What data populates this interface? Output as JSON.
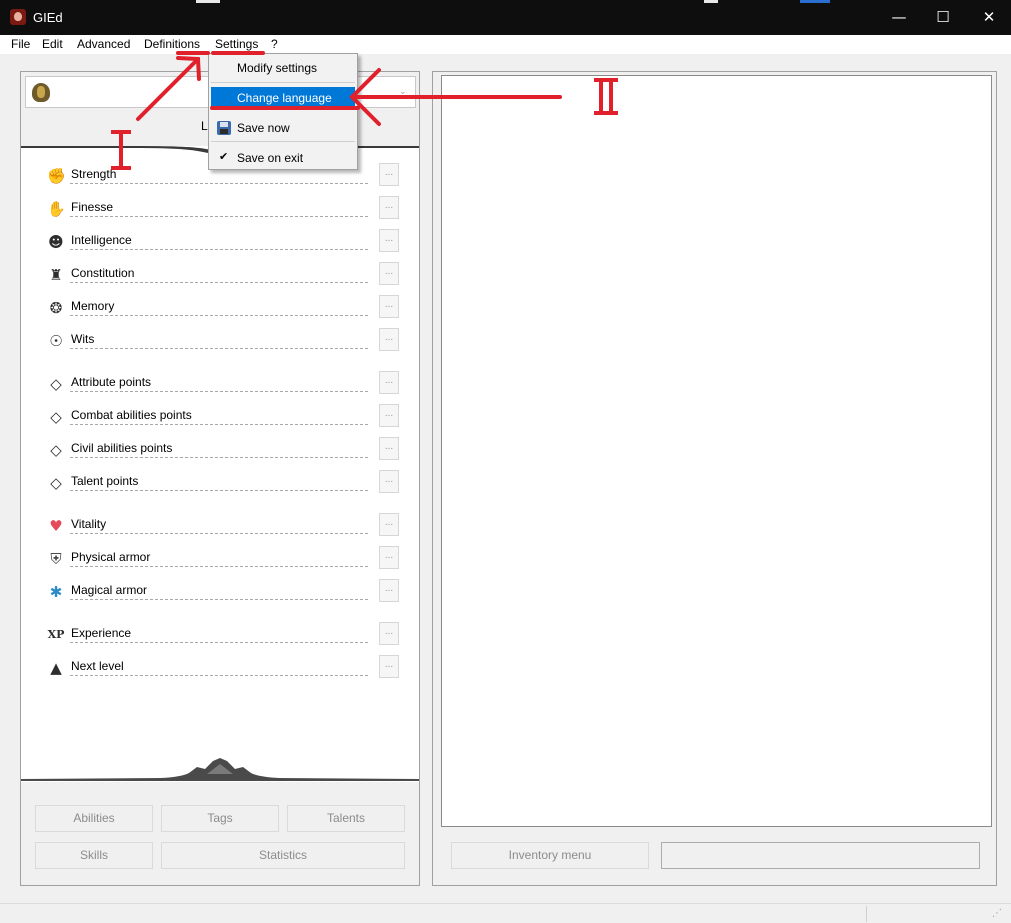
{
  "window": {
    "title": "GIEd",
    "controls": {
      "minimize": "—",
      "maximize": "☐",
      "close": "✕"
    }
  },
  "menu": [
    "File",
    "Edit",
    "Advanced",
    "Definitions",
    "Settings",
    "?"
  ],
  "settings_menu": {
    "items": [
      {
        "label": "Modify settings",
        "icon": "none",
        "highlighted": false
      },
      {
        "label": "Change language",
        "icon": "none",
        "highlighted": true
      },
      {
        "label": "Save now",
        "icon": "floppy-disk-icon",
        "highlighted": false
      },
      {
        "label": "Save on exit",
        "icon": "checkmark-icon",
        "checked": true,
        "highlighted": false
      }
    ]
  },
  "character": {
    "level_label": "L",
    "dropdown_arrow": "⌄"
  },
  "attributes": [
    {
      "label": "Strength",
      "icon": "strength-icon",
      "glyph": "✊",
      "button": "..."
    },
    {
      "label": "Finesse",
      "icon": "finesse-icon",
      "glyph": "✋",
      "button": "..."
    },
    {
      "label": "Intelligence",
      "icon": "intelligence-icon",
      "glyph": "☻",
      "button": "..."
    },
    {
      "label": "Constitution",
      "icon": "constitution-icon",
      "glyph": "♜",
      "button": "..."
    },
    {
      "label": "Memory",
      "icon": "memory-icon",
      "glyph": "❂",
      "button": "..."
    },
    {
      "label": "Wits",
      "icon": "wits-icon",
      "glyph": "☉",
      "button": "..."
    }
  ],
  "points": [
    {
      "label": "Attribute points",
      "icon": "diamond-icon",
      "glyph": "◇",
      "button": "..."
    },
    {
      "label": "Combat abilities points",
      "icon": "diamond-icon",
      "glyph": "◇",
      "button": "..."
    },
    {
      "label": "Civil abilities points",
      "icon": "diamond-icon",
      "glyph": "◇",
      "button": "..."
    },
    {
      "label": "Talent points",
      "icon": "diamond-icon",
      "glyph": "◇",
      "button": "..."
    }
  ],
  "defense": [
    {
      "label": "Vitality",
      "icon": "heart-icon",
      "glyph": "♥",
      "color": "#e44a5a",
      "button": "..."
    },
    {
      "label": "Physical armor",
      "icon": "shield-icon",
      "glyph": "⛨",
      "color": "#4a4a4a",
      "button": "..."
    },
    {
      "label": "Magical armor",
      "icon": "magic-shield-icon",
      "glyph": "✱",
      "color": "#2c8ac8",
      "button": "..."
    }
  ],
  "experience": [
    {
      "label": "Experience",
      "icon": "xp-icon",
      "glyph": "XP",
      "button": "..."
    },
    {
      "label": "Next level",
      "icon": "arrow-up-icon",
      "glyph": "▲",
      "button": "..."
    }
  ],
  "bottom_buttons": {
    "abilities": "Abilities",
    "tags": "Tags",
    "talents": "Talents",
    "skills": "Skills",
    "statistics": "Statistics"
  },
  "right": {
    "inventory_button": "Inventory menu",
    "inventory_field": ""
  },
  "annotations": {
    "color": "#e0202b",
    "label_1": "I",
    "label_2": "II"
  }
}
